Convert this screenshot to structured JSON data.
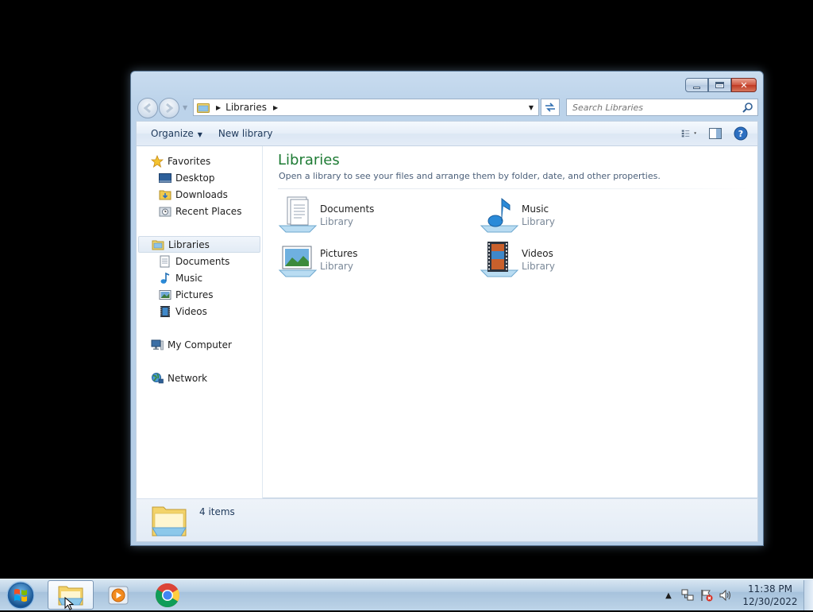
{
  "window": {
    "address": {
      "crumb": "Libraries"
    },
    "search": {
      "placeholder": "Search Libraries"
    },
    "toolbar": {
      "organize_label": "Organize",
      "new_library_label": "New library"
    },
    "nav": {
      "favorites": {
        "label": "Favorites",
        "items": [
          "Desktop",
          "Downloads",
          "Recent Places"
        ]
      },
      "libraries": {
        "label": "Libraries",
        "items": [
          "Documents",
          "Music",
          "Pictures",
          "Videos"
        ]
      },
      "computer": "My Computer",
      "network": "Network"
    },
    "content": {
      "title": "Libraries",
      "subtitle": "Open a library to see your files and arrange them by folder, date, and other properties.",
      "items": [
        {
          "name": "Documents",
          "type": "Library",
          "icon": "documents-library-icon"
        },
        {
          "name": "Music",
          "type": "Library",
          "icon": "music-library-icon"
        },
        {
          "name": "Pictures",
          "type": "Library",
          "icon": "pictures-library-icon"
        },
        {
          "name": "Videos",
          "type": "Library",
          "icon": "videos-library-icon"
        }
      ]
    },
    "details": {
      "count": "4 items"
    }
  },
  "taskbar": {
    "apps": [
      "windows-explorer",
      "media-player",
      "chrome"
    ],
    "clock": {
      "time": "11:38 PM",
      "date": "12/30/2022"
    }
  },
  "colors": {
    "title_green": "#1e7b34",
    "window_frame": "#bcd3ea",
    "taskbar": "#b5cde3"
  }
}
